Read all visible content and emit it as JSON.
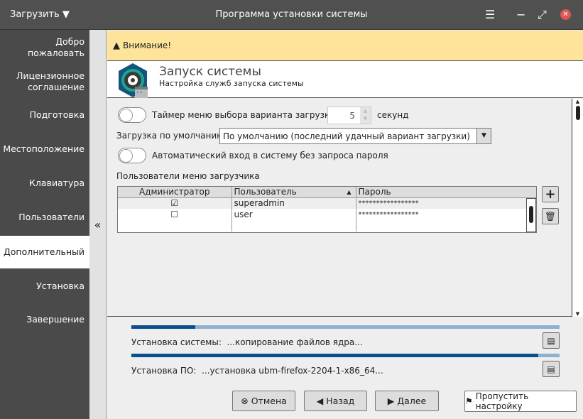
{
  "titlebar": {
    "menu": "Загрузить",
    "title": "Программа установки системы"
  },
  "sidebar": {
    "items": [
      {
        "label": "Добро пожаловать"
      },
      {
        "label": "Лицензионное соглашение"
      },
      {
        "label": "Подготовка"
      },
      {
        "label": "Местоположение"
      },
      {
        "label": "Клавиатура"
      },
      {
        "label": "Пользователи"
      },
      {
        "label": "Дополнительный",
        "active": true
      },
      {
        "label": "Установка"
      },
      {
        "label": "Завершение"
      }
    ],
    "collapse": "«"
  },
  "warning": "Внимание!",
  "header": {
    "title": "Запуск системы",
    "subtitle": "Настройка служб запуска системы"
  },
  "content": {
    "timer_label": "Таймер меню выбора варианта загрузки:",
    "timer_value": "5",
    "timer_unit": "секунд",
    "default_label": "Загрузка по умолчанию:",
    "default_value": "По умолчанию (последний удачный вариант загрузки)",
    "autologin_label": "Автоматический вход в систему без запроса пароля",
    "users_label": "Пользователи меню загрузчика",
    "columns": [
      "Администратор",
      "Пользователь",
      "Пароль"
    ],
    "rows": [
      {
        "admin": true,
        "user": "superadmin",
        "password": "*****************"
      },
      {
        "admin": false,
        "user": "user",
        "password": "*****************"
      }
    ]
  },
  "progress": [
    {
      "label": "Установка системы:",
      "status": "...копирование файлов ядра...",
      "percent": 15
    },
    {
      "label": "Установка ПО:",
      "status": "...установка ubm-firefox-2204-1-x86_64...",
      "percent": 95
    }
  ],
  "buttons": {
    "cancel": "Отмена",
    "back": "Назад",
    "next": "Далее",
    "skip": "Пропустить настройку"
  }
}
